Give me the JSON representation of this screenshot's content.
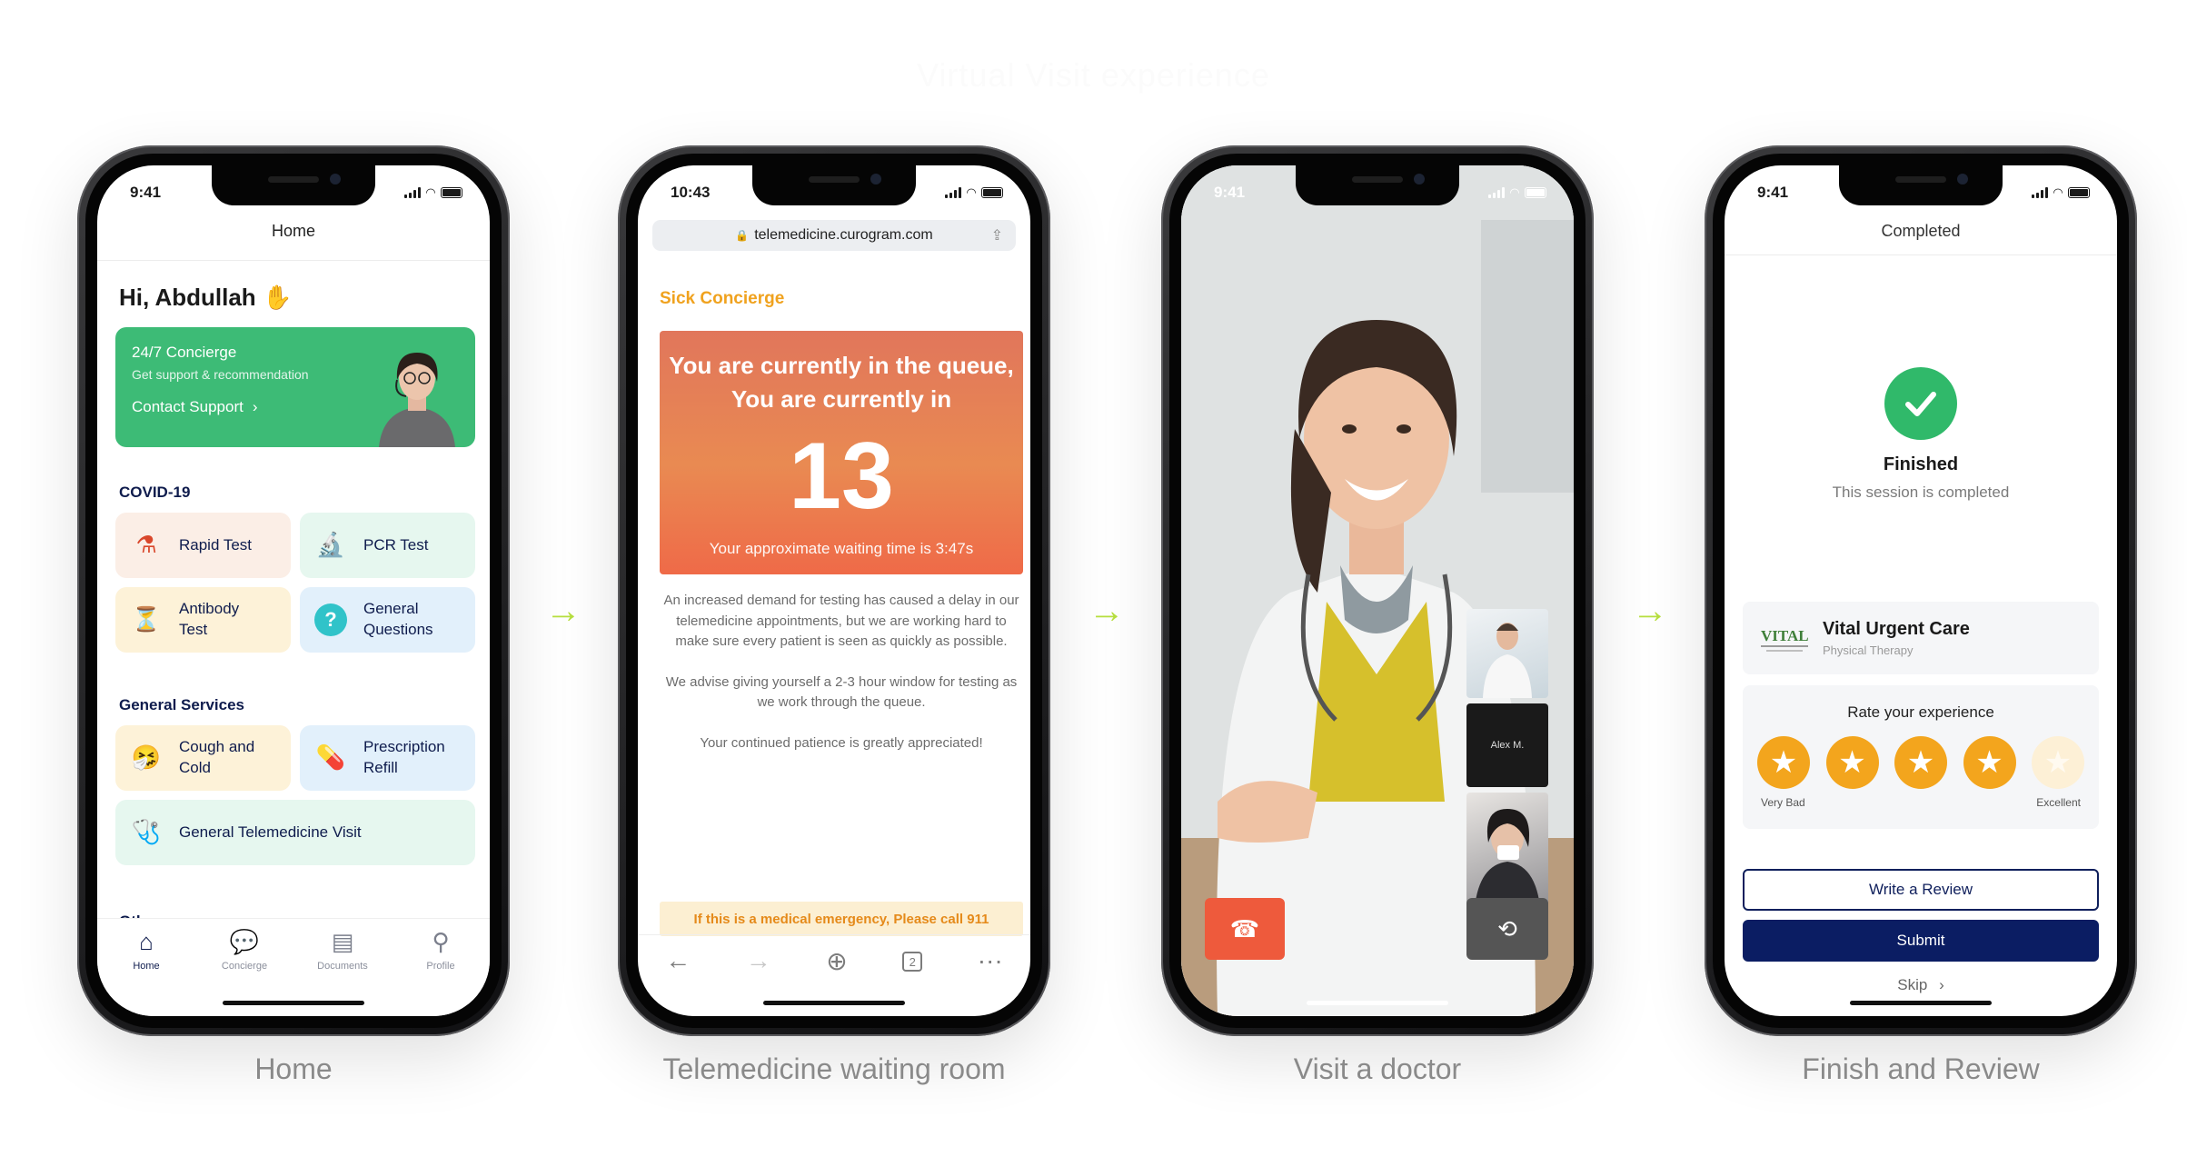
{
  "page": {
    "title": "Virtual Visit experience",
    "captions": [
      "Home",
      "Telemedicine waiting room",
      "Visit a doctor",
      "Finish and Review"
    ],
    "accent_arrow_color": "#b7df3f"
  },
  "home": {
    "time": "9:41",
    "header": "Home",
    "greeting": "Hi, Abdullah",
    "concierge": {
      "title": "24/7 Concierge",
      "subtitle": "Get support & recommendation",
      "cta": "Contact Support",
      "color": "#3dbb76"
    },
    "covid_label": "COVID-19",
    "covid_tiles": [
      "Rapid Test",
      "PCR Test",
      "Antibody Test",
      "General Questions"
    ],
    "services_label": "General Services",
    "service_tiles": [
      "Cough and Cold",
      "Prescription Refill"
    ],
    "telemedicine_tile": "General Telemedicine Visit",
    "others_label": "Others",
    "tabs": [
      "Home",
      "Concierge",
      "Documents",
      "Profile"
    ]
  },
  "tele": {
    "time": "10:43",
    "url": "telemedicine.curogram.com",
    "brand": "Sick Concierge",
    "queue_title": "You are currently in the queue, You are currently in",
    "queue_number": "13",
    "wait": "Your approximate waiting time is 3:47s",
    "p1": "An increased demand for testing has caused a delay in our telemedicine appointments, but we are working hard to make sure every patient is seen as quickly as possible.",
    "p2": "We advise giving yourself a 2-3 hour window for testing as we work through the queue.",
    "p3": "Your continued patience is greatly appreciated!",
    "emergency": "If this is a medical emergency, Please call 911",
    "tab_count": "2"
  },
  "visit": {
    "time": "9:41",
    "pip_name": "Alex M."
  },
  "finish": {
    "time": "9:41",
    "header": "Completed",
    "title": "Finished",
    "subtitle": "This session is completed",
    "clinic_name": "Vital Urgent Care",
    "clinic_sub": "Physical Therapy",
    "logo_text": "VITAL",
    "rate_title": "Rate your experience",
    "rating": 4,
    "rating_max": 5,
    "low_label": "Very Bad",
    "high_label": "Excellent",
    "write_review": "Write a Review",
    "submit": "Submit",
    "skip": "Skip"
  }
}
